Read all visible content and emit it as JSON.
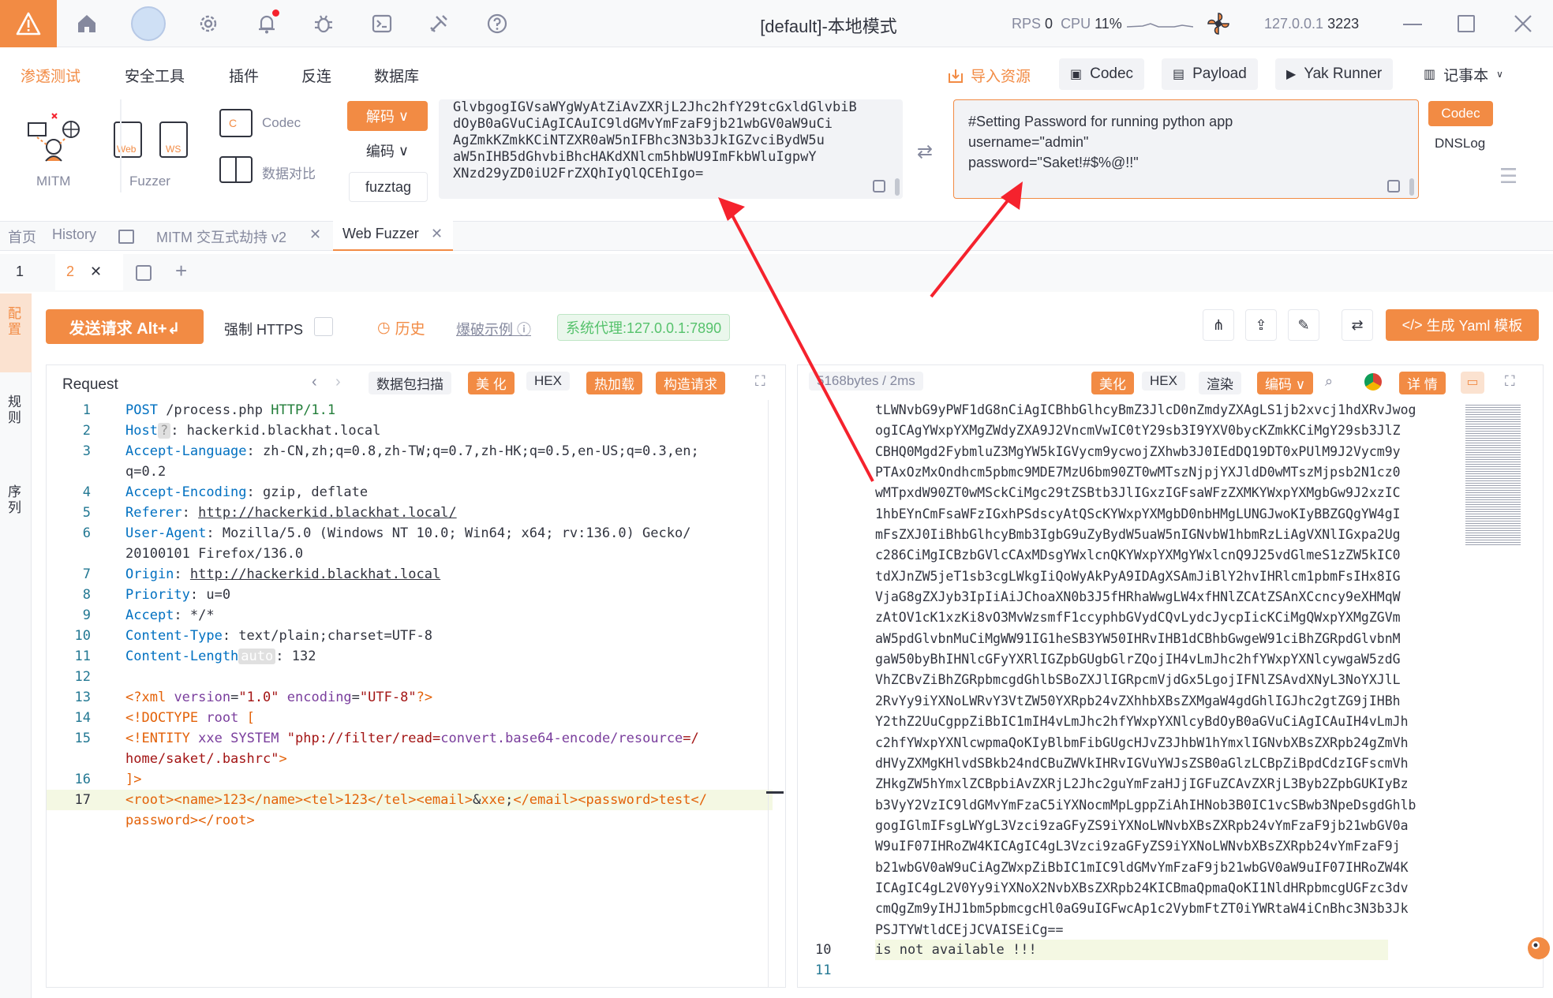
{
  "titlebar": {
    "title": "[default]-本地模式",
    "rps_label": "RPS",
    "rps_value": "0",
    "cpu_label": "CPU",
    "cpu_value": "11%",
    "address": "127.0.0.1",
    "port": "3223"
  },
  "menu": {
    "items": [
      "渗透测试",
      "安全工具",
      "插件",
      "反连",
      "数据库"
    ],
    "right": [
      "导入资源",
      "Codec",
      "Payload",
      "Yak Runner",
      "记事本"
    ]
  },
  "tools": {
    "mitm": "MITM",
    "fuzzer": "Fuzzer",
    "web": "Web",
    "ws": "WS",
    "codec": "Codec",
    "compare": "数据对比",
    "decode_btn": "解码",
    "encode_btn": "编码",
    "fuzztag_btn": "fuzztag",
    "codec_btn": "Codec",
    "dnslog_btn": "DNSLog"
  },
  "codec_input_lines": [
    "GlvbgogIGVsaWYgWyAtZiAvZXRjL2Jhc2hfY29tcGxldGlvbiB",
    "dOyB0aGVuCiAgICAuIC9ldGMvYmFzaF9jb21wbGV0aW9uCi",
    "AgZmkKZmkKCiNTZXR0aW5nIFBhc3N3b3JkIGZvciBydW5u",
    "aW5nIHB5dGhvbiBhcHAKdXNlcm5hbWU9ImFkbWluIgpwY",
    "XNzd29yZD0iU2FrZXQhIyQlQCEhIgo="
  ],
  "codec_output_lines": [
    "#Setting Password for running python app",
    "username=\"admin\"",
    "password=\"Saket!#$%@!!\""
  ],
  "tabs": [
    "首页",
    "History",
    "MITM 交互式劫持 v2",
    "Web Fuzzer"
  ],
  "subtabs": [
    "1",
    "2"
  ],
  "vstrip": [
    "配置",
    "规则",
    "序列"
  ],
  "fuzzer": {
    "send_btn": "发送请求 Alt+↲",
    "force_https": "强制 HTTPS",
    "history": "历史",
    "burst_example": "爆破示例",
    "proxy": "系统代理:127.0.0.1:7890",
    "yaml_btn": "生成 Yaml 模板"
  },
  "request": {
    "title": "Request",
    "btns": [
      "数据包扫描",
      "美 化",
      "HEX",
      "热加载",
      "构造请求"
    ]
  },
  "response": {
    "size": "5168bytes / 2ms",
    "btns": [
      "美化",
      "HEX",
      "渲染",
      "编码",
      "详 情"
    ],
    "b64_lines": [
      "tLWNvbG9yPWF1dG8nCiAgICBhbGlhcyBmZ3JlcD0nZmdyZXAgLS1jb2xvcj1hdXRvJwog",
      "ogICAgYWxpYXMgZWdyZXA9J2VncmVwIC0tY29sb3I9YXV0bycKZmkKCiMgY29sb3JlZ",
      "CBHQ0Mgd2FybmluZ3MgYW5kIGVycm9ycwojZXhwb3J0IEdDQ19DT0xPUlM9J2Vycm9y",
      "PTAxOzMxOndhcm5pbmc9MDE7MzU6bm90ZT0wMTszNjpjYXJldD0wMTszMjpsb2N1cz0",
      "wMTpxdW90ZT0wMSckCiMgc29tZSBtb3JlIGxzIGFsaWFzZXMKYWxpYXMgbGw9J2xzIC",
      "1hbEYnCmFsaWFzIGxhPSdscyAtQScKYWxpYXMgbD0nbHMgLUNGJwoKIyBBZGQgYW4gI",
      "mFsZXJ0IiBhbGlhcyBmb3IgbG9uZyBydW5uaW5nIGNvbW1hbmRzLiAgVXNlIGxpa2Ug",
      "c286CiMgICBzbGVlcCAxMDsgYWxlcnQKYWxpYXMgYWxlcnQ9J25vdGlmeS1zZW5kIC0",
      "tdXJnZW5jeT1sb3cgLWkgIiQoWyAkPyA9IDAgXSAmJiBlY2hvIHRlcm1pbmFsIHx8IG",
      "VjaG8gZXJyb3IpIiAiJChoaXN0b3J5fHRhaWwgLW4xfHNlZCAtZSAnXCcncy9eXHMqW",
      "zAtOV1cK1xzKi8vO3MvWzsmfF1ccyphbGVydCQvLydcJycpIicKCiMgQWxpYXMgZGVm",
      "aW5pdGlvbnMuCiMgWW91IG1heSB3YW50IHRvIHB1dCBhbGwgeW91ciBhZGRpdGlvbnM",
      "gaW50byBhIHNlcGFyYXRlIGZpbGUgbGlrZQojIH4vLmJhc2hfYWxpYXNlcywgaW5zdG",
      "VhZCBvZiBhZGRpbmcgdGhlbSBoZXJlIGRpcmVjdGx5LgojIFNlZSAvdXNyL3NoYXJlL",
      "2RvYy9iYXNoLWRvY3VtZW50YXRpb24vZXhhbXBsZXMgaW4gdGhlIGJhc2gtZG9jIHBh",
      "Y2thZ2UuCgppZiBbIC1mIH4vLmJhc2hfYWxpYXNlcyBdOyB0aGVuCiAgICAuIH4vLmJh",
      "c2hfYWxpYXNlcwpmaQoKIyBlbmFibGUgcHJvZ3JhbW1hYmxlIGNvbXBsZXRpb24gZmVh",
      "dHVyZXMgKHlvdSBkb24ndCBuZWVkIHRvIGVuYWJsZSB0aGlzLCBpZiBpdCdzIGFscmVh",
      "ZHkgZW5hYmxlZCBpbiAvZXRjL2Jhc2guYmFzaHJjIGFuZCAvZXRjL3Byb2ZpbGUKIyBz",
      "b3VyY2VzIC9ldGMvYmFzaC5iYXNocmMpLgppZiAhIHNob3B0IC1vcSBwb3NpeDsgdGhlb",
      "gogIGlmIFsgLWYgL3Vzci9zaGFyZS9iYXNoLWNvbXBsZXRpb24vYmFzaF9jb21wbGV0a",
      "W9uIF07IHRoZW4KICAgIC4gL3Vzci9zaGFyZS9iYXNoLWNvbXBsZXRpb24vYmFzaF9j",
      "b21wbGV0aW9uCiAgZWxpZiBbIC1mIC9ldGMvYmFzaF9jb21wbGV0aW9uIF07IHRoZW4K",
      "ICAgIC4gL2V0Yy9iYXNoX2NvbXBsZXRpb24KICBmaQpmaQoKI1NldHRpbmcgUGFzc3dv",
      "cmQgZm9yIHJ1bm5pbmcgcHl0aG9uIGFwcAp1c2VybmFtZT0iYWRtaW4iCnBhc3N3b3Jk",
      "PSJTYWtldCEjJCVAISEiCg=="
    ],
    "line10_no": "10",
    "line10": "is not available !!!",
    "line11_no": "11"
  }
}
